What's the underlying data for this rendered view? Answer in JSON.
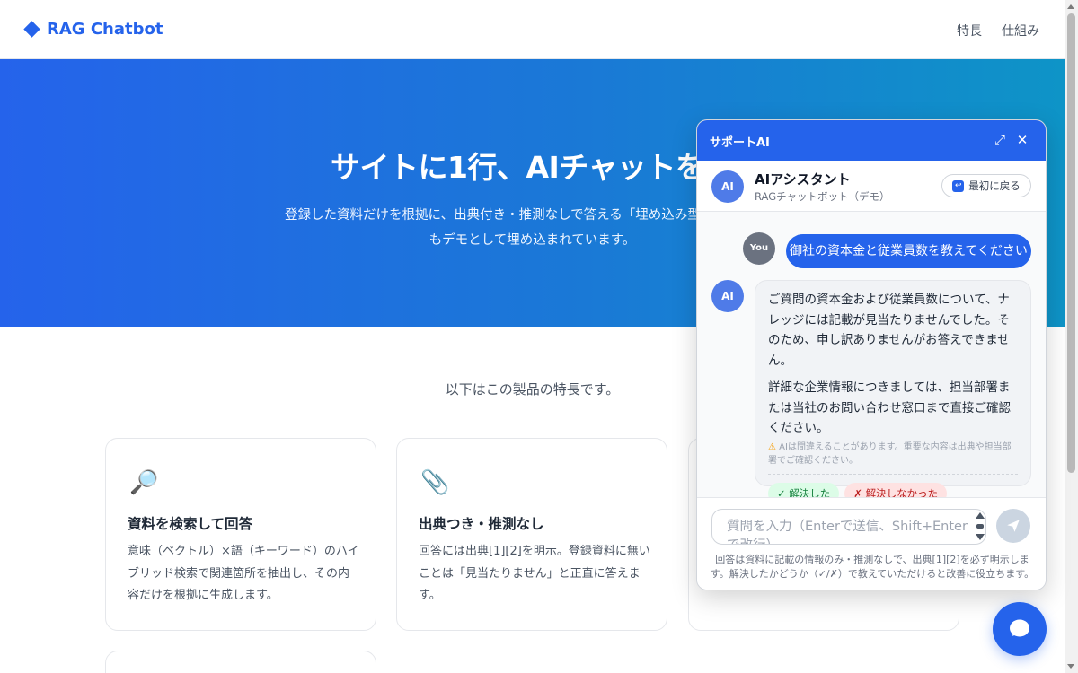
{
  "header": {
    "logo_text": "RAG Chatbot",
    "nav": [
      "特長",
      "仕組み"
    ]
  },
  "hero": {
    "title": "サイトに1行、AIチャットを。",
    "subtitle": "登録した資料だけを根拠に、出典付き・推測なしで答える「埋め込み型RAGチャット",
    "subtitle2": "もデモとして埋め込まれています。"
  },
  "main": {
    "intro": "以下はこの製品の特長です。",
    "features": [
      {
        "icon": "🔎",
        "icon_name": "magnifier-icon",
        "title": "資料を検索して回答",
        "text": "意味（ベクトル）×語（キーワード）のハイブリッド検索で関連箇所を抽出し、その内容だけを根拠に生成します。"
      },
      {
        "icon": "📎",
        "icon_name": "paperclip-icon",
        "title": "出典つき・推測なし",
        "text": "回答には出典[1][2]を明示。登録資料に無いことは「見当たりません」と正直に答えます。"
      }
    ]
  },
  "chat": {
    "header_title": "サポートAI",
    "expand_icon": "⤢",
    "close_icon": "✕",
    "assistant_avatar": "AI",
    "assistant_name": "AIアシスタント",
    "assistant_sub": "RAGチャットボット（デモ）",
    "reset_label": "最初に戻る",
    "user_avatar": "You",
    "user_message": "御社の資本金と従業員数を教えてください",
    "ai_avatar": "AI",
    "ai_p1": "ご質問の資本金および従業員数について、ナレッジには記載が見当たりませんでした。そのため、申し訳ありませんがお答えできません。",
    "ai_p2": "詳細な企業情報につきましては、担当部署または当社のお問い合わせ窓口まで直接ご確認ください。",
    "ai_warning": "AIは間違えることがあります。重要な内容は出典や担当部署でご確認ください。",
    "feedback_yes": "✓ 解決した",
    "feedback_no": "✗ 解決しなかった",
    "input_placeholder": "質問を入力（Enterで送信、Shift+Enterで改行）",
    "input_note": "回答は資料に記載の情報のみ・推測なしで、出典[1][2]を必ず明示します。解決したかどうか（✓/✗）で教えていただけると改善に役立ちます。"
  },
  "colors": {
    "brand": "#2563eb",
    "hero_end": "#0e94c7"
  }
}
